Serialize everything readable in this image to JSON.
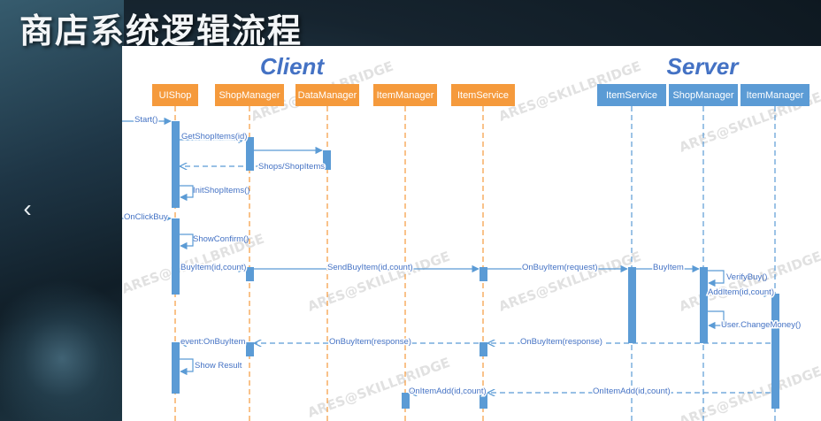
{
  "page_title": "商店系统逻辑流程",
  "group_labels": {
    "client": "Client",
    "server": "Server"
  },
  "watermark": "ARES@SKILLBRIDGE",
  "colors": {
    "client": "#f59a3c",
    "server": "#5b9bd5",
    "line": "#5b9bd5",
    "text": "#4472c4"
  },
  "participants": [
    {
      "id": "c_uishop",
      "label": "UIShop",
      "side": "client"
    },
    {
      "id": "c_shopmgr",
      "label": "ShopManager",
      "side": "client"
    },
    {
      "id": "c_datamgr",
      "label": "DataManager",
      "side": "client"
    },
    {
      "id": "c_itemmgr",
      "label": "ItemManager",
      "side": "client"
    },
    {
      "id": "c_itemsvc",
      "label": "ItemService",
      "side": "client"
    },
    {
      "id": "s_itemsvc",
      "label": "ItemService",
      "side": "server"
    },
    {
      "id": "s_shopmgr",
      "label": "ShopManager",
      "side": "server"
    },
    {
      "id": "s_itemmgr",
      "label": "ItemManager",
      "side": "server"
    }
  ],
  "messages": [
    {
      "label": "Start()",
      "from": "ext",
      "to": "c_uishop",
      "kind": "call"
    },
    {
      "label": "GetShopItems(id)",
      "from": "c_uishop",
      "to": "c_shopmgr",
      "kind": "call"
    },
    {
      "label": "",
      "from": "c_shopmgr",
      "to": "c_datamgr",
      "kind": "call"
    },
    {
      "label": "Shops/ShopItems",
      "from": "c_datamgr",
      "to": "c_uishop",
      "kind": "return"
    },
    {
      "label": "InitShopItems()",
      "from": "c_uishop",
      "to": "c_uishop",
      "kind": "self"
    },
    {
      "label": "OnClickBuy",
      "from": "ext",
      "to": "c_uishop",
      "kind": "call"
    },
    {
      "label": "ShowConfirm()",
      "from": "c_uishop",
      "to": "c_uishop",
      "kind": "self"
    },
    {
      "label": "BuyItem(id,count)",
      "from": "c_uishop",
      "to": "c_shopmgr",
      "kind": "call"
    },
    {
      "label": "SendBuyItem(id,count)",
      "from": "c_shopmgr",
      "to": "c_itemsvc",
      "kind": "call"
    },
    {
      "label": "OnBuyItem(request)",
      "from": "c_itemsvc",
      "to": "s_itemsvc",
      "kind": "call"
    },
    {
      "label": "BuyItem",
      "from": "s_itemsvc",
      "to": "s_shopmgr",
      "kind": "call"
    },
    {
      "label": "VerifyBuy()",
      "from": "s_shopmgr",
      "to": "s_shopmgr",
      "kind": "self"
    },
    {
      "label": "AddItem(id,count)",
      "from": "s_shopmgr",
      "to": "s_itemmgr",
      "kind": "call"
    },
    {
      "label": "User.ChangeMoney()",
      "from": "s_shopmgr",
      "to": "s_shopmgr",
      "kind": "self"
    },
    {
      "label": "OnBuyItem(response)",
      "from": "s_shopmgr",
      "to": "c_itemsvc",
      "kind": "return"
    },
    {
      "label": "OnBuyItem(response)",
      "from": "c_itemsvc",
      "to": "c_shopmgr",
      "kind": "return"
    },
    {
      "label": "event:OnBuyItem",
      "from": "c_shopmgr",
      "to": "c_uishop",
      "kind": "return"
    },
    {
      "label": "Show Result",
      "from": "c_uishop",
      "to": "c_uishop",
      "kind": "self"
    },
    {
      "label": "OnItemAdd(id,count)",
      "from": "s_itemmgr",
      "to": "c_itemsvc",
      "kind": "return"
    },
    {
      "label": "OnItemAdd(id,count)",
      "from": "c_itemsvc",
      "to": "c_itemmgr",
      "kind": "return"
    }
  ]
}
